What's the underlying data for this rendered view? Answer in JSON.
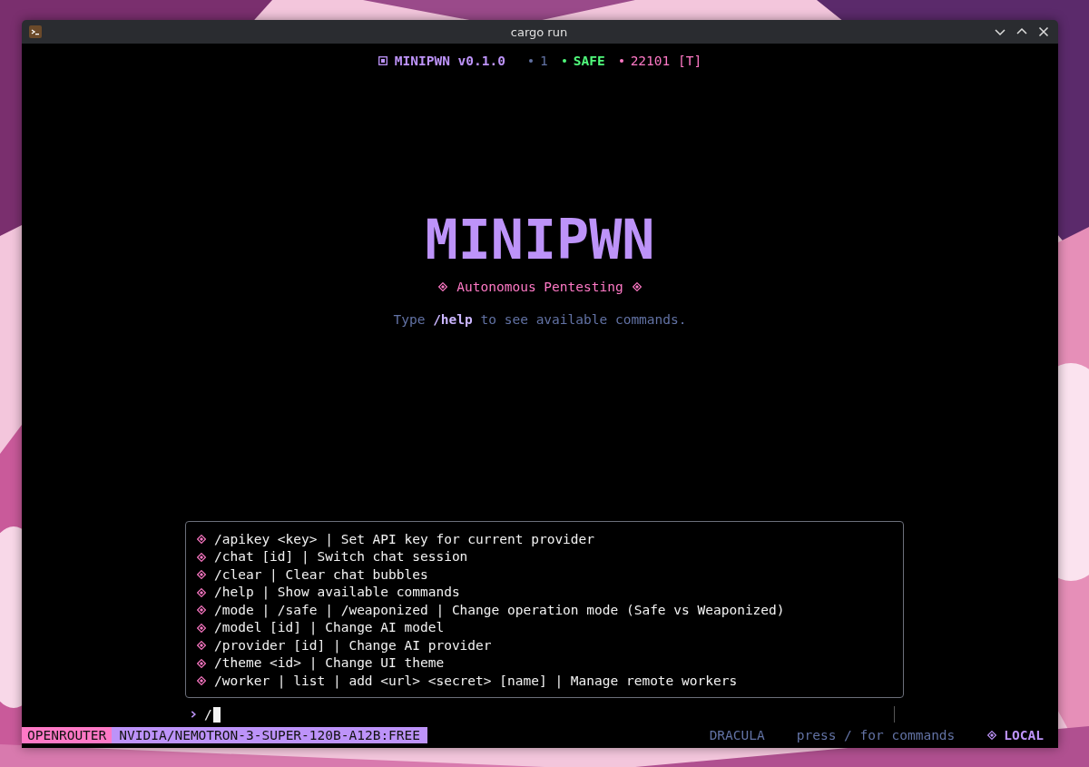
{
  "window": {
    "title": "cargo run"
  },
  "header": {
    "app": "MINIPWN v0.1.0",
    "items": [
      {
        "text": "1",
        "kind": "count"
      },
      {
        "text": "SAFE",
        "kind": "mode"
      },
      {
        "text": "22101 [T]",
        "kind": "port"
      }
    ]
  },
  "logo": "MINIPWN",
  "tagline": "Autonomous Pentesting",
  "hint": "Type **/help** to see available commands.",
  "commands": [
    "/apikey <key> | Set API key for current provider",
    "/chat [id] | Switch chat session",
    "/clear | Clear chat bubbles",
    "/help | Show available commands",
    "/mode | /safe | /weaponized | Change operation mode (Safe vs Weaponized)",
    "/model [id] | Change AI model",
    "/provider [id] | Change AI provider",
    "/theme <id> | Change UI theme",
    "/worker | list | add <url> <secret> [name] | Manage remote workers"
  ],
  "prompt": {
    "value": "/"
  },
  "status_bar": {
    "provider": "OPENROUTER",
    "model": "NVIDIA/NEMOTRON-3-SUPER-120B-A12B:FREE",
    "theme": "DRACULA",
    "hint": "press / for commands",
    "location": "LOCAL"
  }
}
